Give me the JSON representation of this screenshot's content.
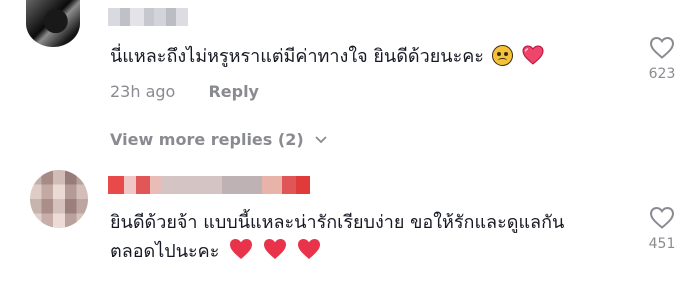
{
  "comments": [
    {
      "text": "นี่แหละถึงไม่หรูหราแต่มีค่าทางใจ ยินดีด้วยนะคะ",
      "time": "23h ago",
      "reply_label": "Reply",
      "likes": "623",
      "emoji": [
        "worried-face",
        "sparkling-heart"
      ]
    },
    {
      "line1": "ยินดีด้วยจ้า แบบนี้แหละน่ารักเรียบง่าย ขอให้รักและดูแลกัน",
      "line2": "ตลอดไปนะคะ",
      "likes": "451",
      "emoji": [
        "red-heart",
        "red-heart",
        "red-heart"
      ]
    }
  ],
  "view_more": "View more replies (2)",
  "colors": {
    "text": "#161823",
    "muted": "#8a8b91",
    "heart": "#e8334b"
  }
}
